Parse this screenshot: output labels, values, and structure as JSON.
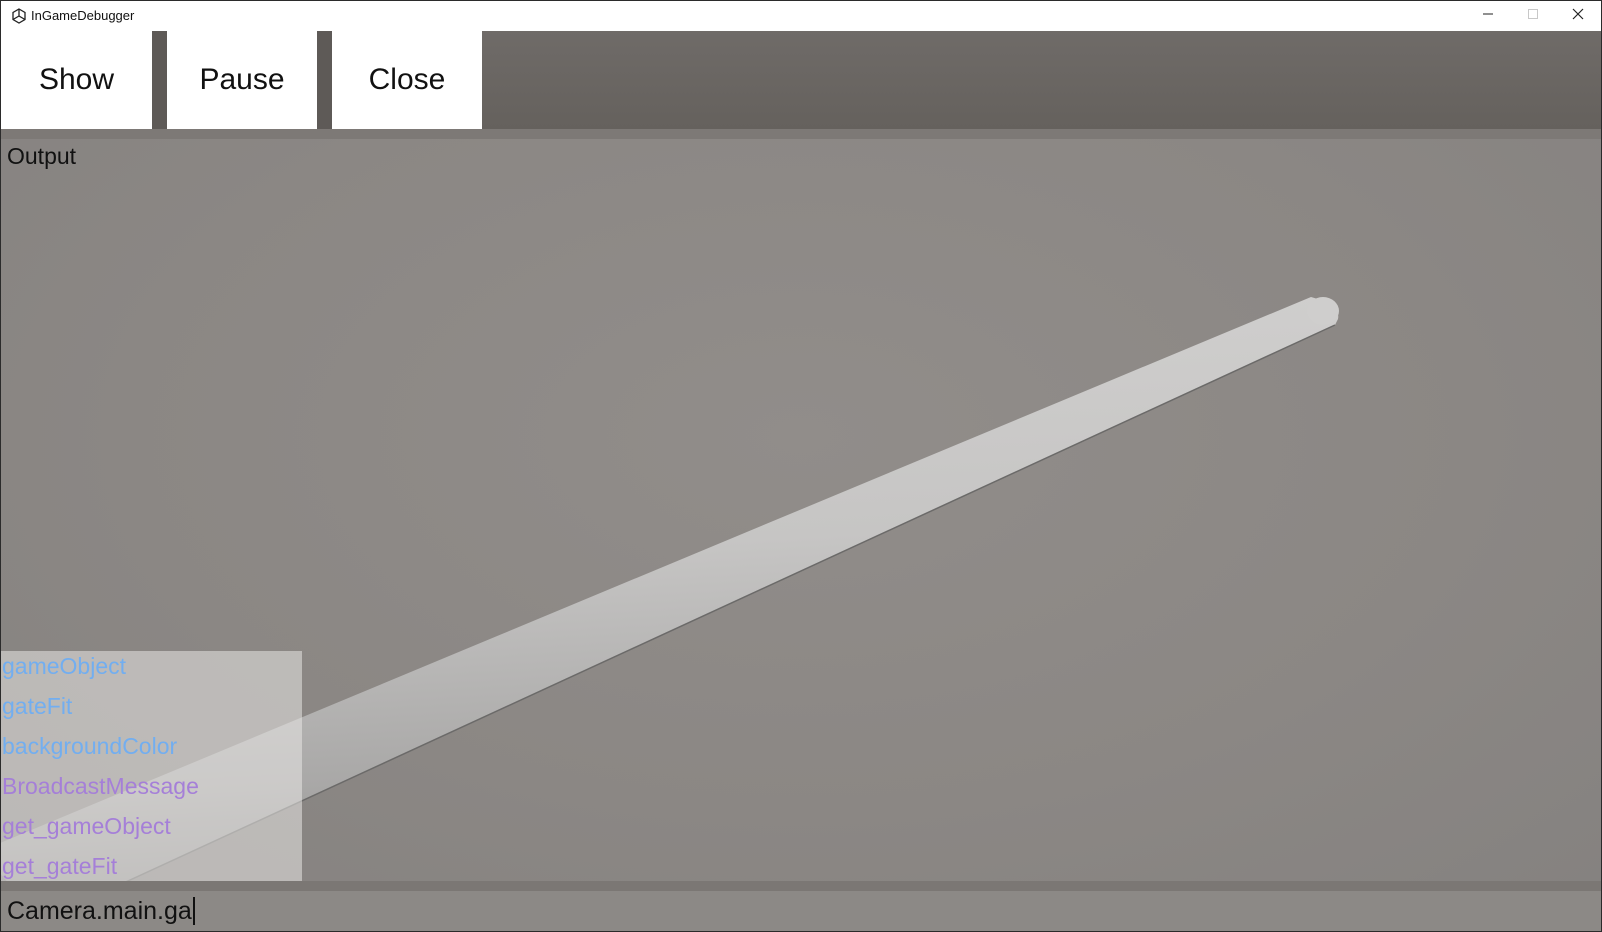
{
  "window": {
    "title": "InGameDebugger",
    "controls": [
      "minimize-icon",
      "maximize-icon",
      "close-icon"
    ]
  },
  "toolbar": {
    "buttons": [
      {
        "label": "Show"
      },
      {
        "label": "Pause"
      },
      {
        "label": "Close"
      }
    ]
  },
  "output": {
    "label": "Output"
  },
  "autocomplete": {
    "items": [
      {
        "text": "gameObject",
        "kind": "field",
        "color": "#72aef0"
      },
      {
        "text": "gateFit",
        "kind": "field",
        "color": "#72aef0"
      },
      {
        "text": "backgroundColor",
        "kind": "field",
        "color": "#72aef0"
      },
      {
        "text": "BroadcastMessage",
        "kind": "method",
        "color": "#a57fd8"
      },
      {
        "text": "get_gameObject",
        "kind": "method",
        "color": "#a57fd8"
      },
      {
        "text": "get_gateFit",
        "kind": "method",
        "color": "#a57fd8"
      }
    ]
  },
  "console": {
    "input_value": "Camera.main.ga"
  },
  "colors": {
    "scene_background": "#8c8986",
    "toolbar_background": "#6a6663",
    "button_background": "#ffffff",
    "field_suggestion": "#72aef0",
    "method_suggestion": "#a57fd8"
  }
}
